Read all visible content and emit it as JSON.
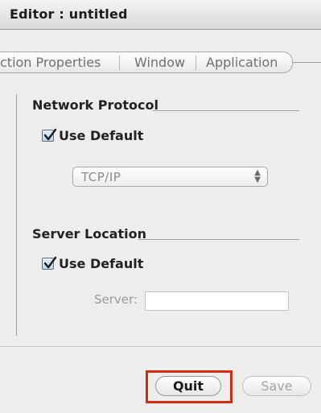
{
  "window": {
    "title": "Editor : untitled"
  },
  "tabs": [
    {
      "label": "ction Properties"
    },
    {
      "label": "Window"
    },
    {
      "label": "Application"
    }
  ],
  "network": {
    "label": "Network Protocol",
    "use_default_label": "Use Default",
    "use_default_checked": true,
    "protocol_selected": "TCP/IP"
  },
  "server_location": {
    "label": "Server Location",
    "use_default_label": "Use Default",
    "use_default_checked": true,
    "server_field_label": "Server:",
    "server_value": ""
  },
  "buttons": {
    "quit_label": "Quit",
    "save_label": "Save"
  },
  "colors": {
    "highlight": "#d12b12"
  }
}
